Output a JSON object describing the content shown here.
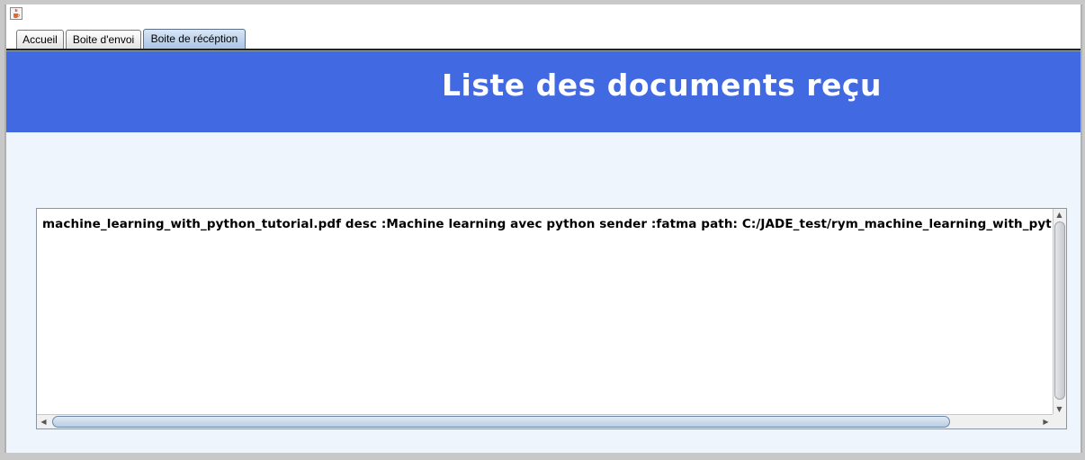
{
  "window": {
    "icon": "java-cup-icon"
  },
  "tabs": [
    {
      "label": "Accueil",
      "selected": false
    },
    {
      "label": "Boite d'envoi",
      "selected": false
    },
    {
      "label": "Boite de récéption",
      "selected": true
    }
  ],
  "header": {
    "title": "Liste des documents reçu",
    "background_color": "#4169e1",
    "text_color": "#ffffff"
  },
  "content": {
    "background_color": "#eef5fd",
    "list_items": [
      "machine_learning_with_python_tutorial.pdf    desc :Machine learning avec python   sender :fatma   path: C:/JADE_test/rym_machine_learning_with_python_tutorial.pdf"
    ]
  },
  "scrollbars": {
    "up_arrow": "▲",
    "down_arrow": "▼",
    "left_arrow": "◀",
    "right_arrow": "▶"
  }
}
